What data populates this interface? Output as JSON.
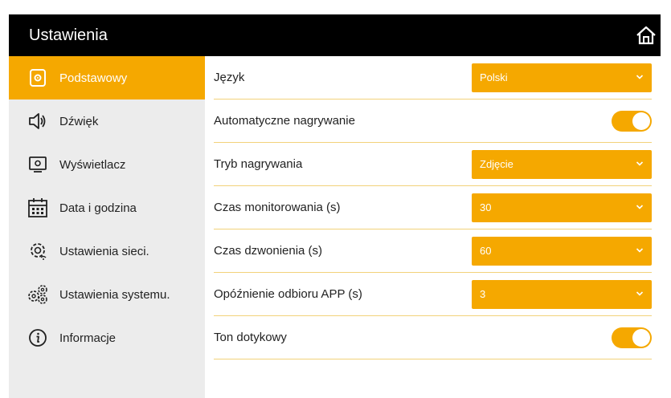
{
  "header": {
    "title": "Ustawienia",
    "home_icon": "home-icon"
  },
  "sidebar": {
    "items": [
      {
        "label": "Podstawowy",
        "icon": "gear-square-icon",
        "active": true
      },
      {
        "label": "Dźwięk",
        "icon": "speaker-icon",
        "active": false
      },
      {
        "label": "Wyświetlacz",
        "icon": "monitor-icon",
        "active": false
      },
      {
        "label": "Data i godzina",
        "icon": "calendar-icon",
        "active": false
      },
      {
        "label": "Ustawienia sieci.",
        "icon": "network-gear-icon",
        "active": false
      },
      {
        "label": "Ustawienia systemu.",
        "icon": "gears-icon",
        "active": false
      },
      {
        "label": "Informacje",
        "icon": "info-icon",
        "active": false
      }
    ]
  },
  "settings": [
    {
      "label": "Język",
      "type": "dropdown",
      "value": "Polski"
    },
    {
      "label": "Automatyczne nagrywanie",
      "type": "toggle",
      "on": true
    },
    {
      "label": "Tryb nagrywania",
      "type": "dropdown",
      "value": "Zdjęcie"
    },
    {
      "label": "Czas monitorowania (s)",
      "type": "dropdown",
      "value": "30"
    },
    {
      "label": "Czas dzwonienia (s)",
      "type": "dropdown",
      "value": "60"
    },
    {
      "label": "Opóźnienie odbioru APP (s)",
      "type": "dropdown",
      "value": "3"
    },
    {
      "label": "Ton dotykowy",
      "type": "toggle",
      "on": true
    }
  ],
  "colors": {
    "accent": "#f5a800",
    "header_bg": "#000000",
    "sidebar_bg": "#ececec"
  }
}
